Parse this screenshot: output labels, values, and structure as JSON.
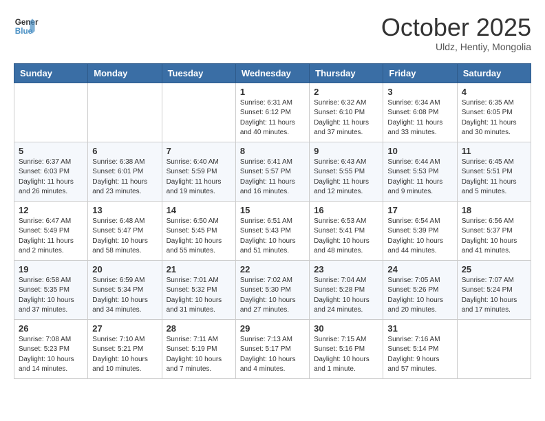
{
  "header": {
    "logo_line1": "General",
    "logo_line2": "Blue",
    "month": "October 2025",
    "location": "Uldz, Hentiy, Mongolia"
  },
  "weekdays": [
    "Sunday",
    "Monday",
    "Tuesday",
    "Wednesday",
    "Thursday",
    "Friday",
    "Saturday"
  ],
  "weeks": [
    [
      {
        "day": "",
        "info": ""
      },
      {
        "day": "",
        "info": ""
      },
      {
        "day": "",
        "info": ""
      },
      {
        "day": "1",
        "info": "Sunrise: 6:31 AM\nSunset: 6:12 PM\nDaylight: 11 hours\nand 40 minutes."
      },
      {
        "day": "2",
        "info": "Sunrise: 6:32 AM\nSunset: 6:10 PM\nDaylight: 11 hours\nand 37 minutes."
      },
      {
        "day": "3",
        "info": "Sunrise: 6:34 AM\nSunset: 6:08 PM\nDaylight: 11 hours\nand 33 minutes."
      },
      {
        "day": "4",
        "info": "Sunrise: 6:35 AM\nSunset: 6:05 PM\nDaylight: 11 hours\nand 30 minutes."
      }
    ],
    [
      {
        "day": "5",
        "info": "Sunrise: 6:37 AM\nSunset: 6:03 PM\nDaylight: 11 hours\nand 26 minutes."
      },
      {
        "day": "6",
        "info": "Sunrise: 6:38 AM\nSunset: 6:01 PM\nDaylight: 11 hours\nand 23 minutes."
      },
      {
        "day": "7",
        "info": "Sunrise: 6:40 AM\nSunset: 5:59 PM\nDaylight: 11 hours\nand 19 minutes."
      },
      {
        "day": "8",
        "info": "Sunrise: 6:41 AM\nSunset: 5:57 PM\nDaylight: 11 hours\nand 16 minutes."
      },
      {
        "day": "9",
        "info": "Sunrise: 6:43 AM\nSunset: 5:55 PM\nDaylight: 11 hours\nand 12 minutes."
      },
      {
        "day": "10",
        "info": "Sunrise: 6:44 AM\nSunset: 5:53 PM\nDaylight: 11 hours\nand 9 minutes."
      },
      {
        "day": "11",
        "info": "Sunrise: 6:45 AM\nSunset: 5:51 PM\nDaylight: 11 hours\nand 5 minutes."
      }
    ],
    [
      {
        "day": "12",
        "info": "Sunrise: 6:47 AM\nSunset: 5:49 PM\nDaylight: 11 hours\nand 2 minutes."
      },
      {
        "day": "13",
        "info": "Sunrise: 6:48 AM\nSunset: 5:47 PM\nDaylight: 10 hours\nand 58 minutes."
      },
      {
        "day": "14",
        "info": "Sunrise: 6:50 AM\nSunset: 5:45 PM\nDaylight: 10 hours\nand 55 minutes."
      },
      {
        "day": "15",
        "info": "Sunrise: 6:51 AM\nSunset: 5:43 PM\nDaylight: 10 hours\nand 51 minutes."
      },
      {
        "day": "16",
        "info": "Sunrise: 6:53 AM\nSunset: 5:41 PM\nDaylight: 10 hours\nand 48 minutes."
      },
      {
        "day": "17",
        "info": "Sunrise: 6:54 AM\nSunset: 5:39 PM\nDaylight: 10 hours\nand 44 minutes."
      },
      {
        "day": "18",
        "info": "Sunrise: 6:56 AM\nSunset: 5:37 PM\nDaylight: 10 hours\nand 41 minutes."
      }
    ],
    [
      {
        "day": "19",
        "info": "Sunrise: 6:58 AM\nSunset: 5:35 PM\nDaylight: 10 hours\nand 37 minutes."
      },
      {
        "day": "20",
        "info": "Sunrise: 6:59 AM\nSunset: 5:34 PM\nDaylight: 10 hours\nand 34 minutes."
      },
      {
        "day": "21",
        "info": "Sunrise: 7:01 AM\nSunset: 5:32 PM\nDaylight: 10 hours\nand 31 minutes."
      },
      {
        "day": "22",
        "info": "Sunrise: 7:02 AM\nSunset: 5:30 PM\nDaylight: 10 hours\nand 27 minutes."
      },
      {
        "day": "23",
        "info": "Sunrise: 7:04 AM\nSunset: 5:28 PM\nDaylight: 10 hours\nand 24 minutes."
      },
      {
        "day": "24",
        "info": "Sunrise: 7:05 AM\nSunset: 5:26 PM\nDaylight: 10 hours\nand 20 minutes."
      },
      {
        "day": "25",
        "info": "Sunrise: 7:07 AM\nSunset: 5:24 PM\nDaylight: 10 hours\nand 17 minutes."
      }
    ],
    [
      {
        "day": "26",
        "info": "Sunrise: 7:08 AM\nSunset: 5:23 PM\nDaylight: 10 hours\nand 14 minutes."
      },
      {
        "day": "27",
        "info": "Sunrise: 7:10 AM\nSunset: 5:21 PM\nDaylight: 10 hours\nand 10 minutes."
      },
      {
        "day": "28",
        "info": "Sunrise: 7:11 AM\nSunset: 5:19 PM\nDaylight: 10 hours\nand 7 minutes."
      },
      {
        "day": "29",
        "info": "Sunrise: 7:13 AM\nSunset: 5:17 PM\nDaylight: 10 hours\nand 4 minutes."
      },
      {
        "day": "30",
        "info": "Sunrise: 7:15 AM\nSunset: 5:16 PM\nDaylight: 10 hours\nand 1 minute."
      },
      {
        "day": "31",
        "info": "Sunrise: 7:16 AM\nSunset: 5:14 PM\nDaylight: 9 hours\nand 57 minutes."
      },
      {
        "day": "",
        "info": ""
      }
    ]
  ]
}
